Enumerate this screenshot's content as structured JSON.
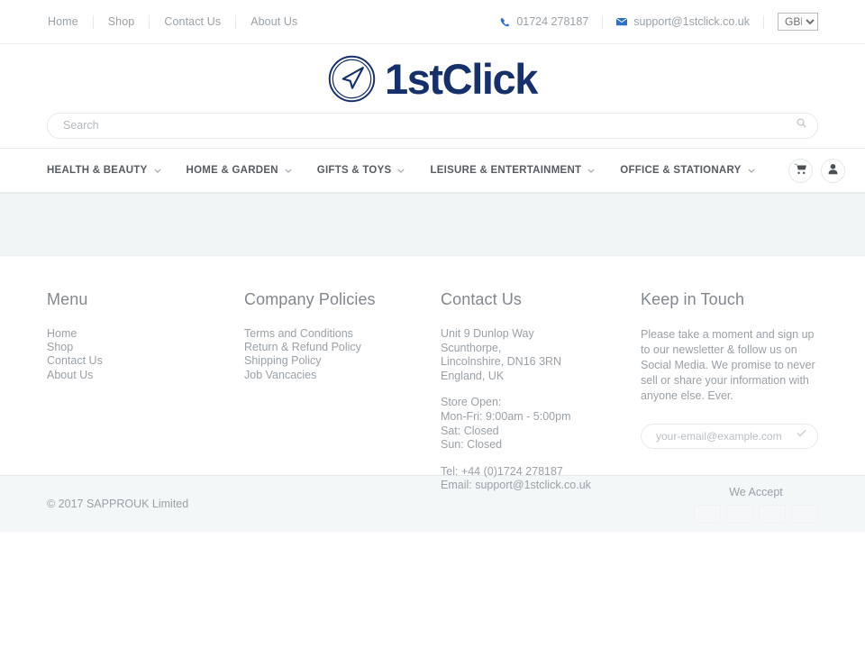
{
  "topbar": {
    "nav": [
      {
        "label": "Home"
      },
      {
        "label": "Shop"
      },
      {
        "label": "Contact Us"
      },
      {
        "label": "About Us"
      }
    ],
    "phone": "01724 278187",
    "email": "support@1stclick.co.uk",
    "currency_selected": "GBP",
    "currency_options": [
      "GBP"
    ]
  },
  "brand": {
    "name": "1stClick",
    "logo_color": "#16306b",
    "icon": "navigation-arrow-circle-icon"
  },
  "search": {
    "placeholder": "Search",
    "value": "",
    "icon": "search-icon"
  },
  "mainnav": {
    "items": [
      {
        "label": "HEALTH & BEAUTY"
      },
      {
        "label": "HOME & GARDEN"
      },
      {
        "label": "GIFTS & TOYS"
      },
      {
        "label": "LEISURE & ENTERTAINMENT"
      },
      {
        "label": "OFFICE & STATIONARY"
      }
    ],
    "cart_icon": "shopping-cart-icon",
    "account_icon": "user-account-icon"
  },
  "content_band": {
    "text": ""
  },
  "footer": {
    "menu": {
      "title": "Menu",
      "links": [
        {
          "label": "Home"
        },
        {
          "label": "Shop"
        },
        {
          "label": "Contact Us"
        },
        {
          "label": "About Us"
        }
      ]
    },
    "policies": {
      "title": "Company Policies",
      "links": [
        {
          "label": "Terms and Conditions"
        },
        {
          "label": "Return & Refund Policy"
        },
        {
          "label": "Shipping Policy"
        },
        {
          "label": "Job Vancacies"
        }
      ]
    },
    "contact": {
      "title": "Contact Us",
      "address": [
        "Unit 9 Dunlop Way",
        "Scunthorpe,",
        "Lincolnshire, DN16 3RN",
        "England, UK"
      ],
      "hours": [
        "Store Open:",
        "Mon-Fri: 9:00am - 5:00pm",
        "Sat: Closed",
        "Sun: Closed"
      ],
      "details": [
        "Tel: +44 (0)1724 278187",
        "Email: support@1stclick.co.uk"
      ]
    },
    "keepintouch": {
      "title": "Keep in Touch",
      "text": "Please take a moment and sign up to our newsletter & follow us on Social Media. We promise to never sell or share your information with anyone else. Ever.",
      "placeholder": "your-email@example.com",
      "value": "",
      "submit_icon": "check-icon"
    }
  },
  "bottombar": {
    "copyright": "© 2017 SAPPROUK Limited",
    "accept_label": "We Accept",
    "cards": [
      {
        "name": "payment-card-1"
      },
      {
        "name": "payment-card-2"
      },
      {
        "name": "payment-card-3"
      },
      {
        "name": "payment-card-4"
      }
    ]
  },
  "colors": {
    "brand_navy": "#16306b",
    "accent_blue": "#2f6fc4",
    "band_bg": "#f1f5f6",
    "text_muted": "#9aa1a7"
  }
}
